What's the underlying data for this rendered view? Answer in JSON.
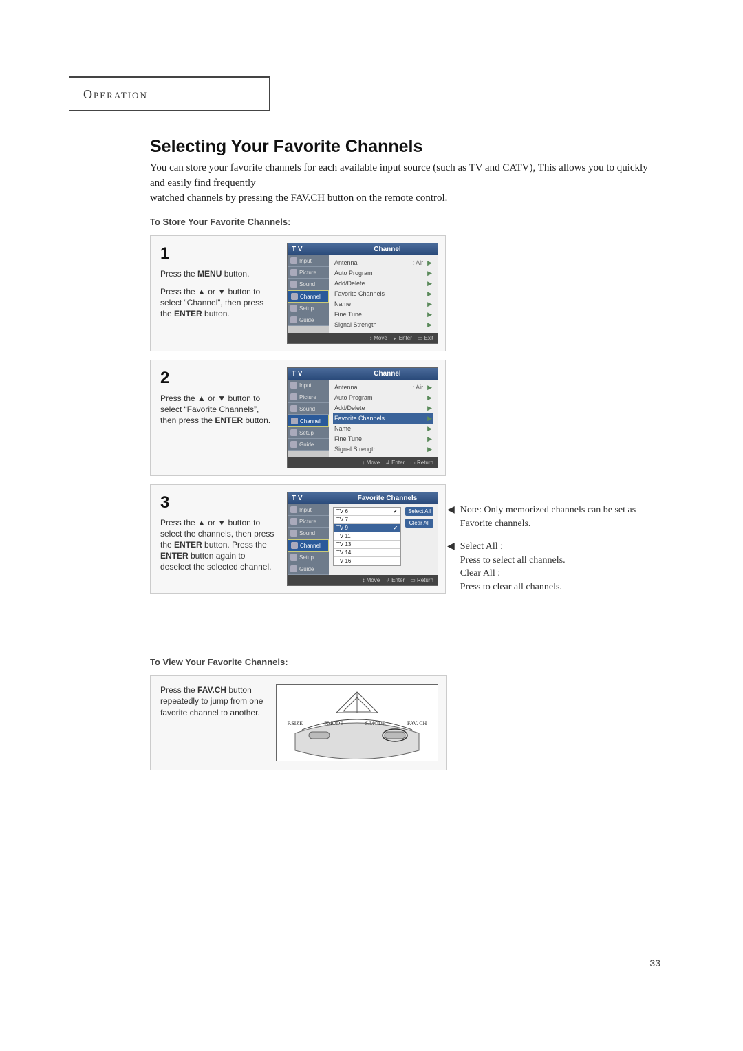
{
  "header": {
    "section": "Operation"
  },
  "main": {
    "title": "Selecting Your Favorite Channels",
    "intro_line1": "You can store your favorite channels for each available input source (such as TV and CATV), This allows you to quickly and easily find frequently",
    "intro_line2": "watched channels by pressing the FAV.CH button on the remote control.",
    "subhead_store": "To Store Your Favorite Channels:",
    "subhead_view": "To View Your Favorite Channels:"
  },
  "steps": [
    {
      "num": "1",
      "line1_pre": "Press the ",
      "line1_bold": "MENU",
      "line1_post": " button.",
      "line2_pre": "Press the ▲ or ▼ button to select “Channel”, then press the ",
      "line2_bold": "ENTER",
      "line2_post": " button.",
      "osd": {
        "side_title": "T V",
        "main_title": "Channel",
        "sidebar": [
          "Input",
          "Picture",
          "Sound",
          "Channel",
          "Setup",
          "Guide"
        ],
        "active_idx": 3,
        "rows": [
          {
            "label": "Antenna",
            "value": ":  Air",
            "arrow": "▶"
          },
          {
            "label": "Auto Program",
            "value": "",
            "arrow": "▶"
          },
          {
            "label": "Add/Delete",
            "value": "",
            "arrow": "▶"
          },
          {
            "label": "Favorite Channels",
            "value": "",
            "arrow": "▶"
          },
          {
            "label": "Name",
            "value": "",
            "arrow": "▶"
          },
          {
            "label": "Fine Tune",
            "value": "",
            "arrow": "▶"
          },
          {
            "label": "Signal Strength",
            "value": "",
            "arrow": "▶"
          }
        ],
        "highlight_row": -1,
        "footer": [
          "Move",
          "Enter",
          "Exit"
        ]
      }
    },
    {
      "num": "2",
      "line1_pre": "Press the ▲ or ▼ button to select “Favorite Channels”, then press the ",
      "line1_bold": "ENTER",
      "line1_post": " button.",
      "osd": {
        "side_title": "T V",
        "main_title": "Channel",
        "sidebar": [
          "Input",
          "Picture",
          "Sound",
          "Channel",
          "Setup",
          "Guide"
        ],
        "active_idx": 3,
        "rows": [
          {
            "label": "Antenna",
            "value": ":  Air",
            "arrow": "▶"
          },
          {
            "label": "Auto Program",
            "value": "",
            "arrow": "▶"
          },
          {
            "label": "Add/Delete",
            "value": "",
            "arrow": "▶"
          },
          {
            "label": "Favorite Channels",
            "value": "",
            "arrow": "▶"
          },
          {
            "label": "Name",
            "value": "",
            "arrow": "▶"
          },
          {
            "label": "Fine Tune",
            "value": "",
            "arrow": "▶"
          },
          {
            "label": "Signal Strength",
            "value": "",
            "arrow": "▶"
          }
        ],
        "highlight_row": 3,
        "footer": [
          "Move",
          "Enter",
          "Return"
        ]
      }
    },
    {
      "num": "3",
      "line1_pre": "Press the ▲ or ▼ button to select the channels, then press the ",
      "line1_bold": "ENTER",
      "line1_post": " button. Press the ",
      "line2_bold": "ENTER",
      "line2_post": " button again to deselect the selected channel.",
      "osd": {
        "side_title": "T V",
        "main_title": "Favorite Channels",
        "sidebar": [
          "Input",
          "Picture",
          "Sound",
          "Channel",
          "Setup",
          "Guide"
        ],
        "active_idx": 3,
        "list": [
          "TV 6",
          "TV 7",
          "TV 9",
          "TV 11",
          "TV 13",
          "TV 14",
          "TV 16"
        ],
        "checked": [
          0,
          2
        ],
        "highlight_row": 2,
        "buttons": [
          "Select All",
          "Clear All"
        ],
        "footer": [
          "Move",
          "Enter",
          "Return"
        ]
      }
    }
  ],
  "notes": {
    "n1": "Note: Only memorized channels can be set as Favorite channels.",
    "n2_head1": "Select All :",
    "n2_body1": "Press to select all channels.",
    "n2_head2": "Clear All :",
    "n2_body2": "Press to clear all channels."
  },
  "favch": {
    "text_pre": "Press the ",
    "text_bold": "FAV.CH",
    "text_post": " button repeatedly to jump from one favorite channel to another.",
    "remote_labels": [
      "P.SIZE",
      "PMODE",
      "S.MODE",
      "FAV. CH"
    ]
  },
  "page_number": "33"
}
